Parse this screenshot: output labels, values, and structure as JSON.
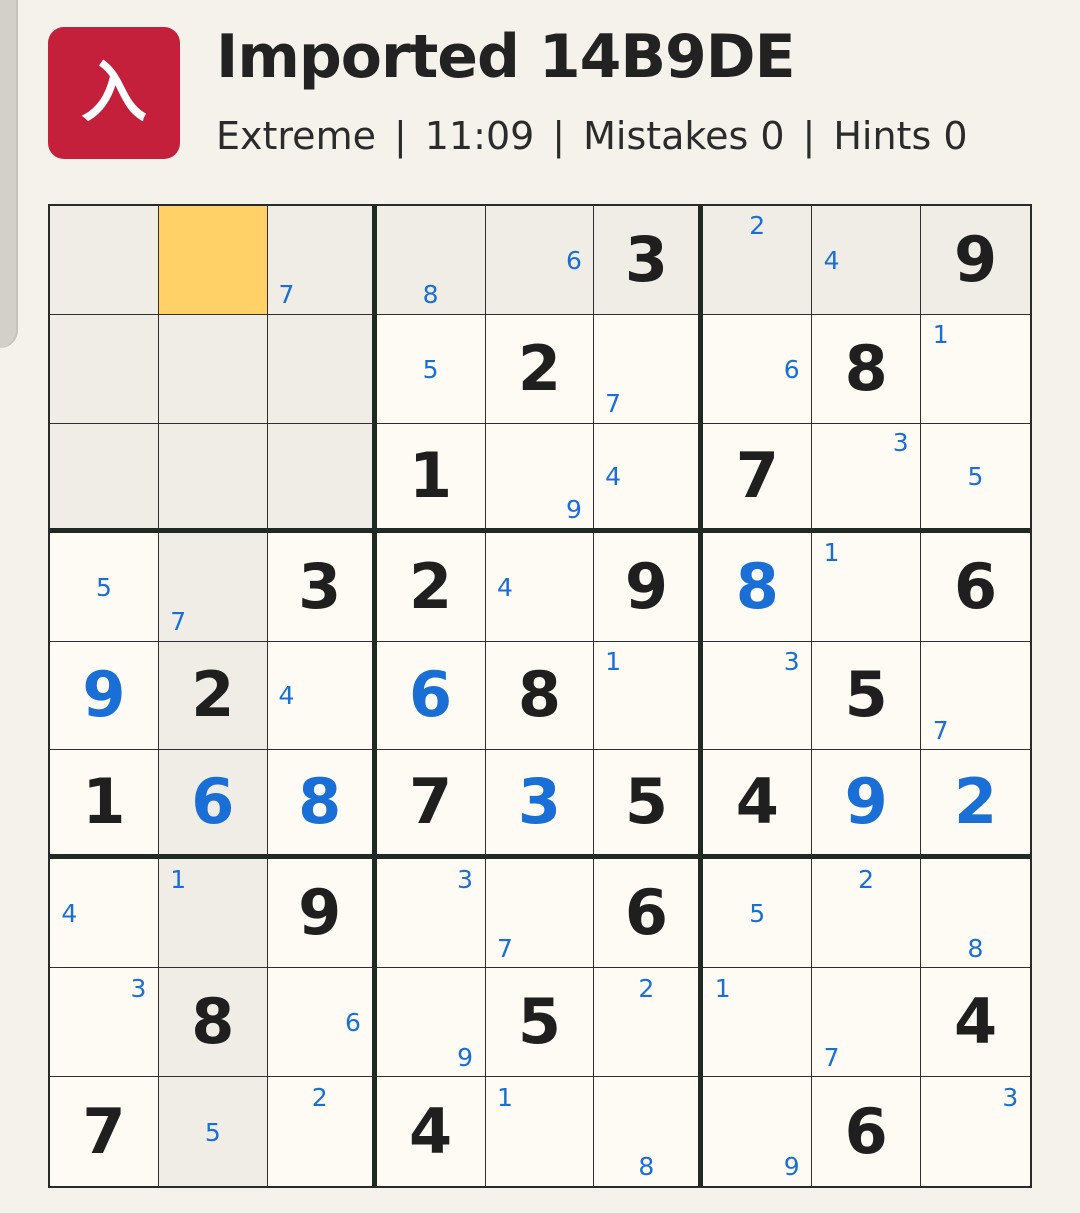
{
  "header": {
    "logo_glyph": "入",
    "title": "Imported 14B9DE",
    "difficulty": "Extreme",
    "timer": "11:09",
    "mistakes": "Mistakes 0",
    "hints": "Hints 0",
    "separator": "|"
  },
  "colors": {
    "accent": "#c4203b",
    "given_digit": "#1f1f1f",
    "user_digit": "#1a6fd6",
    "note": "#1a6fd6",
    "selected": "#ffd167",
    "highlight": "#efede5"
  },
  "board": {
    "selected_cell": [
      0,
      1
    ],
    "rows": [
      [
        {
          "notes": []
        },
        {
          "notes": []
        },
        {
          "notes": [
            "7"
          ]
        },
        {
          "notes": [
            "8"
          ]
        },
        {
          "notes": [
            "6"
          ]
        },
        {
          "value": "3"
        },
        {
          "notes": [
            "2"
          ]
        },
        {
          "notes": [
            "4"
          ]
        },
        {
          "value": "9"
        }
      ],
      [
        {
          "notes": []
        },
        {
          "notes": []
        },
        {
          "notes": []
        },
        {
          "notes": [
            "5"
          ]
        },
        {
          "value": "2"
        },
        {
          "notes": [
            "7"
          ]
        },
        {
          "notes": [
            "6"
          ]
        },
        {
          "value": "8"
        },
        {
          "notes": [
            "1"
          ]
        }
      ],
      [
        {
          "notes": []
        },
        {
          "notes": []
        },
        {
          "notes": []
        },
        {
          "value": "1"
        },
        {
          "notes": [
            "9"
          ]
        },
        {
          "notes": [
            "4"
          ]
        },
        {
          "value": "7"
        },
        {
          "notes": [
            "3"
          ]
        },
        {
          "notes": [
            "5"
          ]
        }
      ],
      [
        {
          "notes": [
            "5"
          ]
        },
        {
          "notes": [
            "7"
          ]
        },
        {
          "value": "3"
        },
        {
          "value": "2"
        },
        {
          "notes": [
            "4"
          ]
        },
        {
          "value": "9"
        },
        {
          "value": "8",
          "user": true
        },
        {
          "notes": [
            "1"
          ]
        },
        {
          "value": "6"
        }
      ],
      [
        {
          "value": "9",
          "user": true
        },
        {
          "value": "2"
        },
        {
          "notes": [
            "4"
          ]
        },
        {
          "value": "6",
          "user": true
        },
        {
          "value": "8"
        },
        {
          "notes": [
            "1"
          ]
        },
        {
          "notes": [
            "3"
          ]
        },
        {
          "value": "5"
        },
        {
          "notes": [
            "7"
          ]
        }
      ],
      [
        {
          "value": "1"
        },
        {
          "value": "6",
          "user": true
        },
        {
          "value": "8",
          "user": true
        },
        {
          "value": "7"
        },
        {
          "value": "3",
          "user": true
        },
        {
          "value": "5"
        },
        {
          "value": "4"
        },
        {
          "value": "9",
          "user": true
        },
        {
          "value": "2",
          "user": true
        }
      ],
      [
        {
          "notes": [
            "4"
          ]
        },
        {
          "notes": [
            "1"
          ]
        },
        {
          "value": "9"
        },
        {
          "notes": [
            "3"
          ]
        },
        {
          "notes": [
            "7"
          ]
        },
        {
          "value": "6"
        },
        {
          "notes": [
            "5"
          ]
        },
        {
          "notes": [
            "2"
          ]
        },
        {
          "notes": [
            "8"
          ]
        }
      ],
      [
        {
          "notes": [
            "3"
          ]
        },
        {
          "value": "8"
        },
        {
          "notes": [
            "6"
          ]
        },
        {
          "notes": [
            "9"
          ]
        },
        {
          "value": "5"
        },
        {
          "notes": [
            "2"
          ]
        },
        {
          "notes": [
            "1"
          ]
        },
        {
          "notes": [
            "7"
          ]
        },
        {
          "value": "4"
        }
      ],
      [
        {
          "value": "7"
        },
        {
          "notes": [
            "5"
          ]
        },
        {
          "notes": [
            "2"
          ]
        },
        {
          "value": "4"
        },
        {
          "notes": [
            "1"
          ]
        },
        {
          "notes": [
            "8"
          ]
        },
        {
          "notes": [
            "9"
          ]
        },
        {
          "value": "6"
        },
        {
          "notes": [
            "3"
          ]
        }
      ]
    ]
  }
}
